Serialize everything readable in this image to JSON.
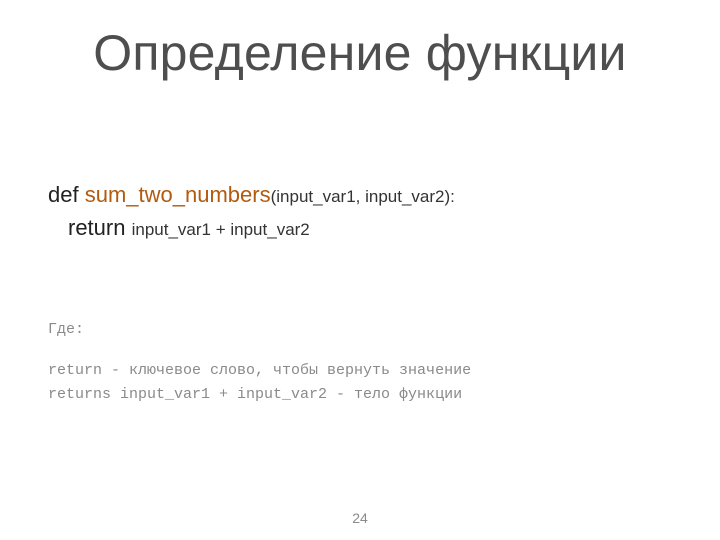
{
  "title": "Определение функции",
  "code": {
    "def_kw": "def",
    "fn_name": "sum_two_numbers",
    "params": "(input_var1, input_var2):",
    "return_kw": "return",
    "return_expr": "input_var1 + input_var2"
  },
  "explain": {
    "where_label": "Где:",
    "line_return": "return - ключевое слово, чтобы вернуть значение",
    "line_body": "returns input_var1 + input_var2 - тело функции"
  },
  "page_number": "24"
}
